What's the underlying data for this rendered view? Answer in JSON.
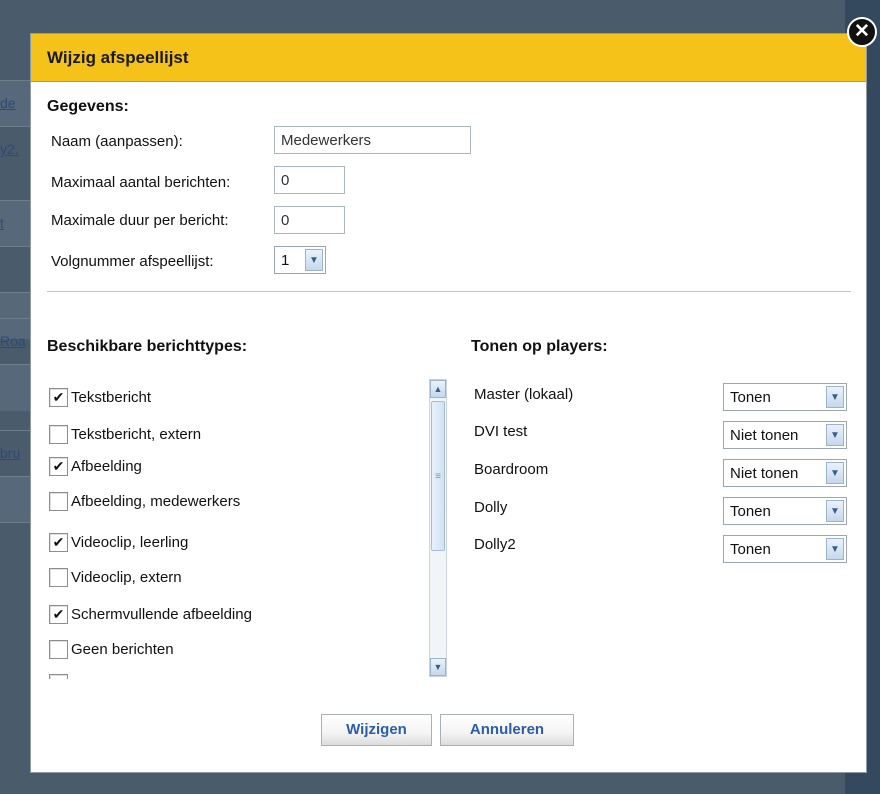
{
  "background": {
    "rows": [
      {
        "text": "de"
      },
      {
        "text": "y2."
      },
      {
        "text": "t"
      },
      {
        "text": ""
      },
      {
        "text": ""
      },
      {
        "text": "Roa"
      },
      {
        "text": ""
      },
      {
        "text": "bru"
      },
      {
        "text": ""
      },
      {
        "text": ""
      }
    ]
  },
  "dialog": {
    "title": "Wijzig afspeellijst",
    "close_glyph": "✕",
    "details": {
      "heading": "Gegevens:",
      "name_label": "Naam (aanpassen):",
      "name_value": "Medewerkers",
      "max_messages_label": "Maximaal aantal berichten:",
      "max_messages_value": "0",
      "max_duration_label": "Maximale duur per bericht:",
      "max_duration_value": "0",
      "order_label": "Volgnummer afspeellijst:",
      "order_value": "1"
    },
    "types": {
      "heading": "Beschikbare berichttypes:",
      "items": [
        {
          "label": "Tekstbericht",
          "checked": true
        },
        {
          "label": "Tekstbericht, extern",
          "checked": false
        },
        {
          "label": "Afbeelding",
          "checked": true
        },
        {
          "label": "Afbeelding, medewerkers",
          "checked": false
        },
        {
          "label": "Videoclip, leerling",
          "checked": true
        },
        {
          "label": "Videoclip, extern",
          "checked": false
        },
        {
          "label": "Schermvullende afbeelding",
          "checked": true
        },
        {
          "label": "Geen berichten",
          "checked": false
        },
        {
          "label": "",
          "checked": false
        }
      ]
    },
    "players": {
      "heading": "Tonen op players:",
      "items": [
        {
          "name": "Master (lokaal)",
          "value": "Tonen"
        },
        {
          "name": "DVI test",
          "value": "Niet tonen"
        },
        {
          "name": "Boardroom",
          "value": "Niet tonen"
        },
        {
          "name": "Dolly",
          "value": "Tonen"
        },
        {
          "name": "Dolly2",
          "value": "Tonen"
        }
      ]
    },
    "buttons": {
      "save": "Wijzigen",
      "cancel": "Annuleren"
    },
    "glyphs": {
      "check": "✔",
      "dropdown": "▼",
      "scroll_up": "▲",
      "scroll_down": "▼",
      "thumb_grip": "≡"
    }
  }
}
